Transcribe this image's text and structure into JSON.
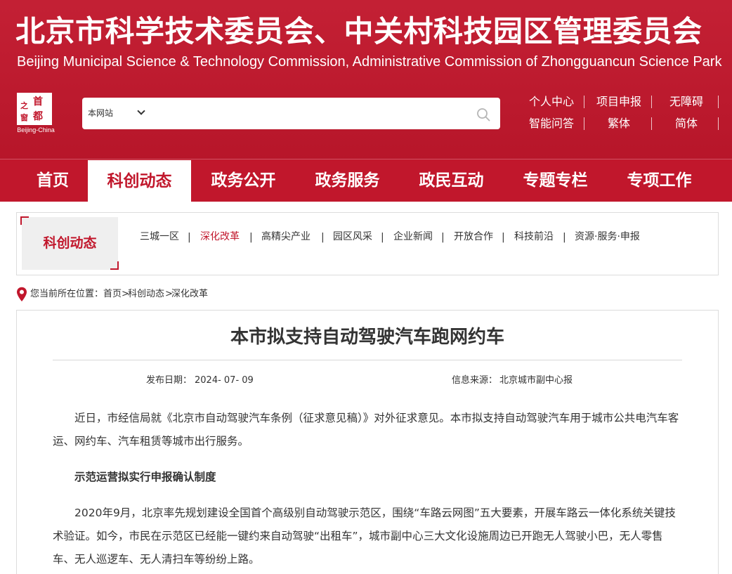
{
  "header": {
    "title_cn": "北京市科学技术委员会、中关村科技园区管理委员会",
    "title_en": "Beijing Municipal Science & Technology Commission, Administrative Commission of Zhongguancun Science Park",
    "logo": {
      "chars": [
        "首",
        "都",
        "之",
        "窗"
      ],
      "subtitle": "Beijing-China"
    },
    "search": {
      "scope_selected": "本网站",
      "placeholder": "",
      "icon": "search-icon"
    },
    "utility_links": [
      "个人中心",
      "项目申报",
      "无障碍",
      "智能问答",
      "繁体",
      "简体"
    ]
  },
  "nav": {
    "items": [
      "首页",
      "科创动态",
      "政务公开",
      "政务服务",
      "政民互动",
      "专题专栏",
      "专项工作"
    ],
    "active": "科创动态"
  },
  "subnav": {
    "label": "科创动态",
    "items": [
      "三城一区",
      "深化改革",
      "高精尖产业",
      "园区风采",
      "企业新闻",
      "开放合作",
      "科技前沿",
      "资源·服务·申报"
    ],
    "active": "深化改革",
    "separator": "|"
  },
  "breadcrumb": {
    "prefix": "您当前所在位置：",
    "items": [
      "首页",
      "科创动态",
      "深化改革"
    ],
    "separator": ">"
  },
  "article": {
    "title": "本市拟支持自动驾驶汽车跑网约车",
    "date_label": "发布日期：",
    "date": "2024- 07- 09",
    "source_label": "信息来源：",
    "source": "北京城市副中心报",
    "paragraphs": [
      "近日，市经信局就《北京市自动驾驶汽车条例（征求意见稿）》对外征求意见。本市拟支持自动驾驶汽车用于城市公共电汽车客运、网约车、汽车租赁等城市出行服务。",
      "2020年9月，北京率先规划建设全国首个高级别自动驾驶示范区，围绕“车路云网图”五大要素，开展车路云一体化系统关键技术验证。如今，市民在示范区已经能一键约来自动驾驶“出租车”，城市副中心三大文化设施周边已开跑无人驾驶小巴，无人零售车、无人巡逻车、无人清扫车等纷纷上路。"
    ],
    "subheading": "示范运营拟实行申报确认制度"
  },
  "colors": {
    "brand_red": "#c1172c",
    "text": "#333333",
    "panel_gray": "#efefef",
    "border": "#dcdcdc"
  }
}
